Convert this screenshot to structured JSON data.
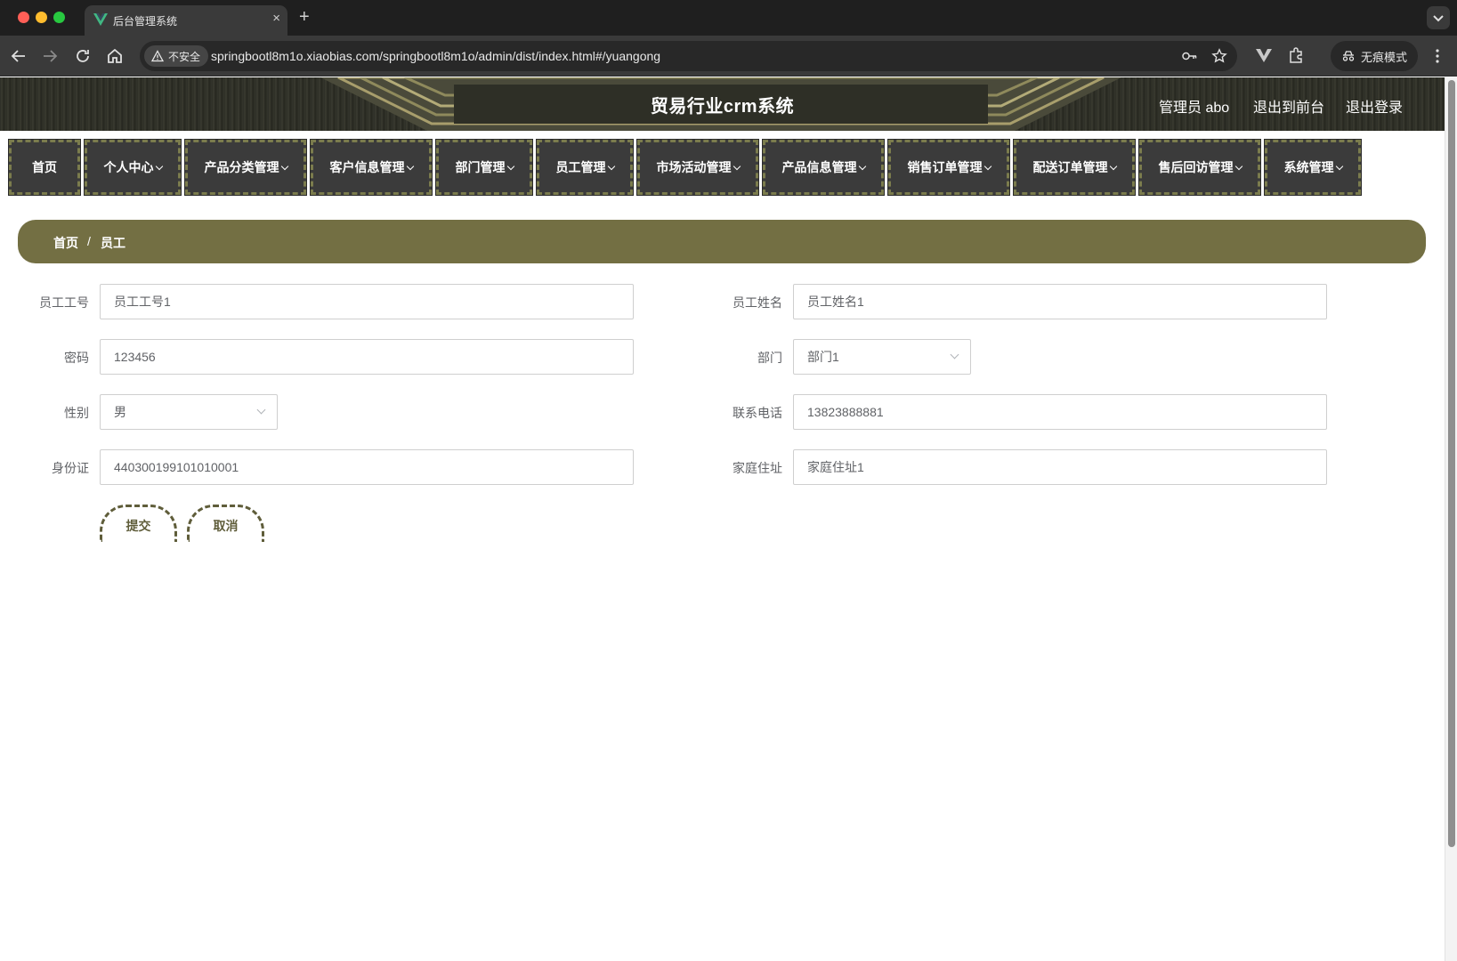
{
  "browser": {
    "tab_title": "后台管理系统",
    "tab_close": "×",
    "new_tab": "+",
    "security_label": "不安全",
    "url": "springbootl8m1o.xiaobias.com/springbootl8m1o/admin/dist/index.html#/yuangong",
    "incognito_label": "无痕模式"
  },
  "header": {
    "title": "贸易行业crm系统",
    "user_label": "管理员 abo",
    "to_front": "退出到前台",
    "logout": "退出登录"
  },
  "nav": {
    "items": [
      {
        "label": "首页"
      },
      {
        "label": "个人中心"
      },
      {
        "label": "产品分类管理"
      },
      {
        "label": "客户信息管理"
      },
      {
        "label": "部门管理"
      },
      {
        "label": "员工管理"
      },
      {
        "label": "市场活动管理"
      },
      {
        "label": "产品信息管理"
      },
      {
        "label": "销售订单管理"
      },
      {
        "label": "配送订单管理"
      },
      {
        "label": "售后回访管理"
      },
      {
        "label": "系统管理"
      }
    ]
  },
  "breadcrumb": {
    "home": "首页",
    "separator": "/",
    "current": "员工"
  },
  "form": {
    "employee_no_label": "员工工号",
    "employee_no_value": "员工工号1",
    "employee_name_label": "员工姓名",
    "employee_name_value": "员工姓名1",
    "password_label": "密码",
    "password_value": "123456",
    "department_label": "部门",
    "department_value": "部门1",
    "gender_label": "性别",
    "gender_value": "男",
    "phone_label": "联系电话",
    "phone_value": "13823888881",
    "id_card_label": "身份证",
    "id_card_value": "440300199101010001",
    "address_label": "家庭住址",
    "address_value": "家庭住址1",
    "submit_label": "提交",
    "cancel_label": "取消"
  },
  "colors": {
    "accent_olive": "#736f43",
    "nav_bg": "#3b3b3b",
    "nav_border": "#7b7c4d"
  }
}
